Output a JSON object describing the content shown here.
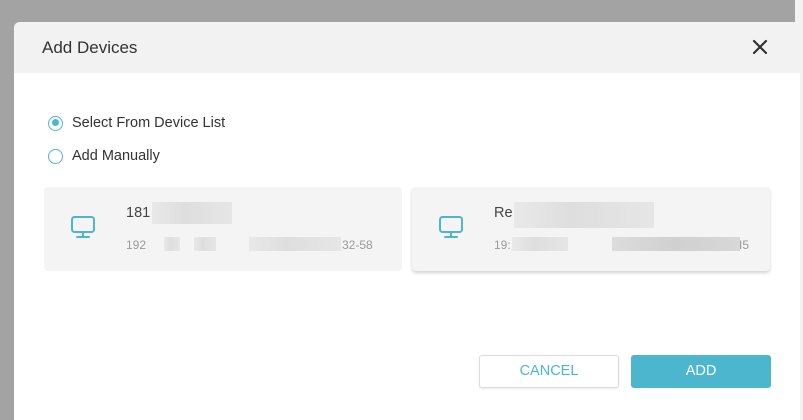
{
  "dialog": {
    "title": "Add Devices",
    "close_icon": "close-icon"
  },
  "options": [
    {
      "label": "Select From Device List",
      "checked": true
    },
    {
      "label": "Add Manually",
      "checked": false
    }
  ],
  "devices": [
    {
      "name": "181",
      "mac": "192",
      "mac_tail": "32-58",
      "icon": "monitor-icon"
    },
    {
      "name": "Re",
      "mac": "19:",
      "mac_tail": "I5",
      "icon": "monitor-icon"
    }
  ],
  "buttons": {
    "cancel_label": "CANCEL",
    "add_label": "ADD"
  },
  "colors": {
    "accent": "#4db6cf",
    "header_bg": "#f2f2f2",
    "card_bg": "#f4f4f4"
  }
}
